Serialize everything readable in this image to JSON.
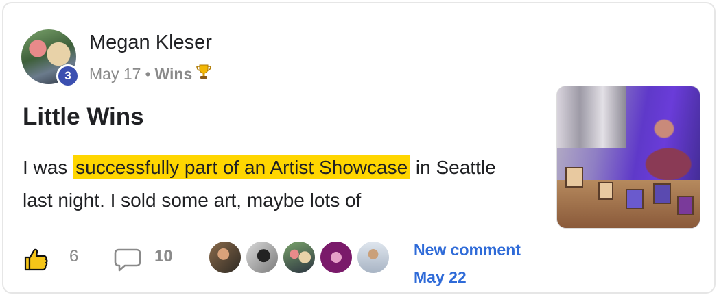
{
  "post": {
    "author": "Megan Kleser",
    "level": "3",
    "date": "May 17",
    "separator": "•",
    "category": "Wins",
    "category_icon": "trophy-icon",
    "title": "Little Wins",
    "body_before": "I was ",
    "body_highlight": "successfully part of an Artist Showcase",
    "body_after": " in Seattle last night. I sold some art, maybe lots of"
  },
  "footer": {
    "like_count": "6",
    "comment_count": "10",
    "new_comment_label": "New comment",
    "new_comment_date": "May 22"
  },
  "colors": {
    "highlight": "#ffd600",
    "link": "#2f6bd8",
    "level_badge": "#3b4fb0"
  }
}
